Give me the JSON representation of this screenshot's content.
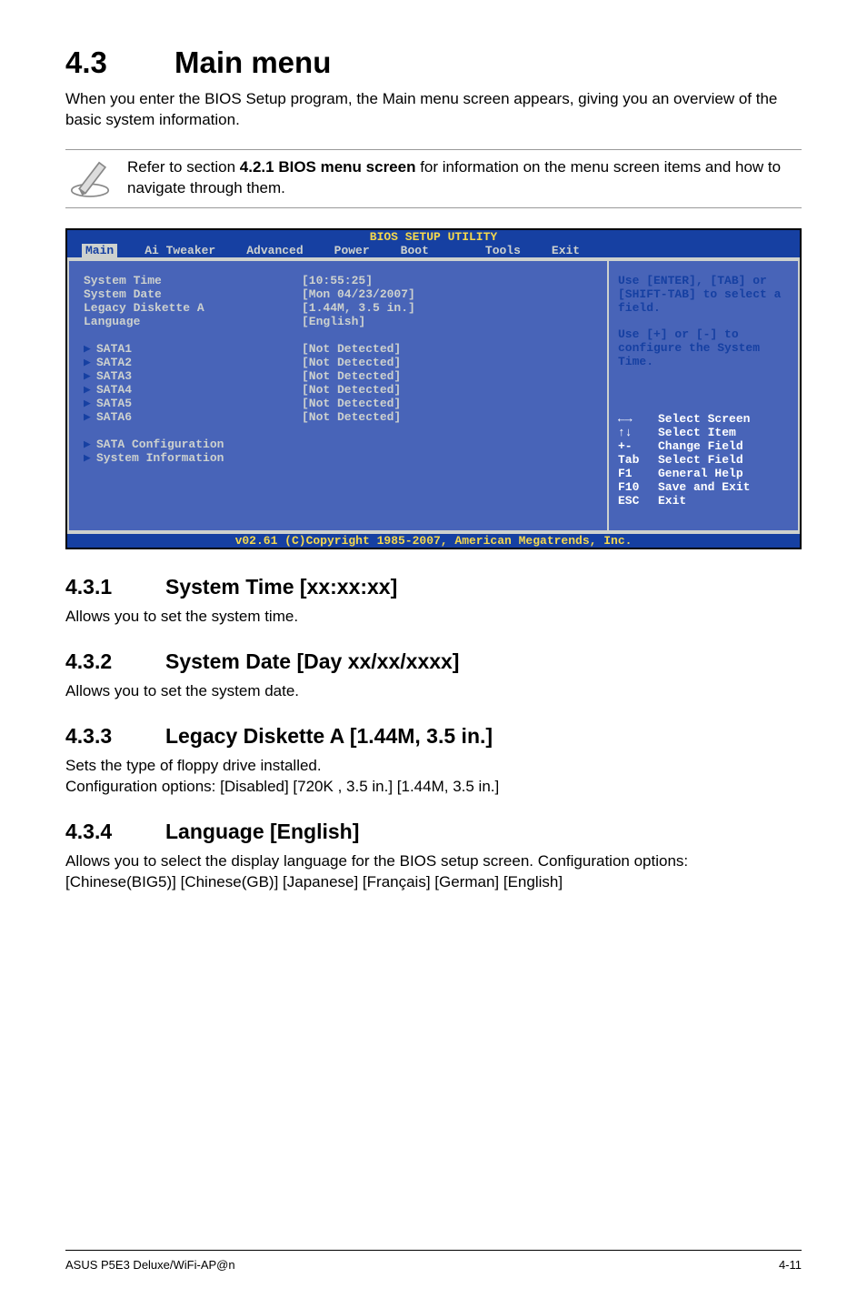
{
  "heading": {
    "num": "4.3",
    "title": "Main menu"
  },
  "intro": "When you enter the BIOS Setup program, the Main menu screen appears, giving you an overview of the basic system information.",
  "note": {
    "prefix": "Refer to section ",
    "bold": "4.2.1  BIOS menu screen",
    "suffix": " for information on the menu screen items and how to navigate through them."
  },
  "bios": {
    "title": "BIOS SETUP UTILITY",
    "tabs": [
      "Main",
      "Ai Tweaker",
      "Advanced",
      "Power",
      "Boot",
      "Tools",
      "Exit"
    ],
    "fields": [
      {
        "label": "System Time",
        "value": "[10:55:25]"
      },
      {
        "label": "System Date",
        "value": "[Mon 04/23/2007]"
      },
      {
        "label": "Legacy Diskette A",
        "value": "[1.44M, 3.5 in.]"
      },
      {
        "label": "Language",
        "value": "[English]"
      }
    ],
    "sata": [
      {
        "label": "SATA1",
        "value": "[Not Detected]"
      },
      {
        "label": "SATA2",
        "value": "[Not Detected]"
      },
      {
        "label": "SATA3",
        "value": "[Not Detected]"
      },
      {
        "label": "SATA4",
        "value": "[Not Detected]"
      },
      {
        "label": "SATA5",
        "value": "[Not Detected]"
      },
      {
        "label": "SATA6",
        "value": "[Not Detected]"
      }
    ],
    "submenus": [
      "SATA Configuration",
      "System Information"
    ],
    "help_top": "Use [ENTER], [TAB] or [SHIFT-TAB] to select a field.",
    "help_mid": "Use [+] or [-] to configure the System Time.",
    "nav": [
      {
        "key": "←→",
        "desc": "Select Screen"
      },
      {
        "key": "↑↓",
        "desc": "Select Item"
      },
      {
        "key": "+-",
        "desc": "Change Field"
      },
      {
        "key": "Tab",
        "desc": "Select Field"
      },
      {
        "key": "F1",
        "desc": "General Help"
      },
      {
        "key": "F10",
        "desc": "Save and Exit"
      },
      {
        "key": "ESC",
        "desc": "Exit"
      }
    ],
    "footer": "v02.61 (C)Copyright 1985-2007, American Megatrends, Inc."
  },
  "sections": [
    {
      "num": "4.3.1",
      "title": "System Time [xx:xx:xx]",
      "body": "Allows you to set the system time."
    },
    {
      "num": "4.3.2",
      "title": "System Date [Day xx/xx/xxxx]",
      "body": "Allows you to set the system date."
    },
    {
      "num": "4.3.3",
      "title": "Legacy Diskette A [1.44M, 3.5 in.]",
      "body": "Sets the type of floppy drive installed.\nConfiguration options: [Disabled] [720K , 3.5 in.] [1.44M, 3.5 in.]"
    },
    {
      "num": "4.3.4",
      "title": "Language [English]",
      "body": "Allows you to select the display language for the BIOS setup screen. Configuration options: [Chinese(BIG5)] [Chinese(GB)] [Japanese] [Français] [German] [English]"
    }
  ],
  "footer": {
    "left": "ASUS P5E3 Deluxe/WiFi-AP@n",
    "right": "4-11"
  }
}
